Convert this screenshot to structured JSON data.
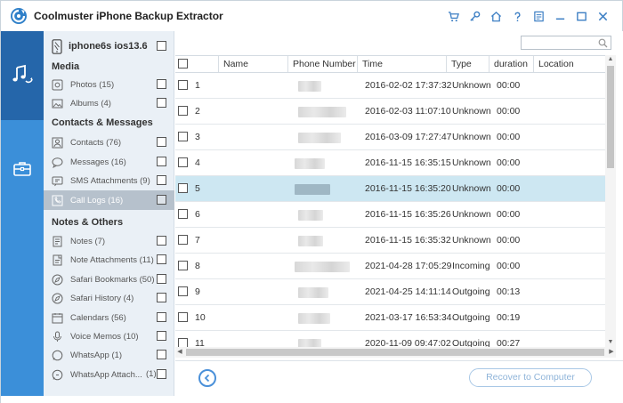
{
  "app": {
    "title": "Coolmuster iPhone Backup Extractor",
    "title_icons": [
      "cart-icon",
      "key-icon",
      "home-icon",
      "help-icon",
      "feedback-icon",
      "minimize-icon",
      "maximize-icon",
      "close-icon"
    ],
    "accent_color": "#3b8fd9",
    "rail_active_color": "#2566aa"
  },
  "device": {
    "name": "iphone6s ios13.6"
  },
  "sections": {
    "media": "Media",
    "contacts_messages": "Contacts & Messages",
    "notes_others": "Notes & Others"
  },
  "categories": [
    {
      "label": "Photos  (15)",
      "icon": "photo-icon"
    },
    {
      "label": "Albums  (4)",
      "icon": "album-icon"
    },
    {
      "label": "Contacts  (76)",
      "icon": "contacts-icon"
    },
    {
      "label": "Messages  (16)",
      "icon": "messages-icon"
    },
    {
      "label": "SMS Attachments  (9)",
      "icon": "attachment-icon"
    },
    {
      "label": "Call Logs  (16)",
      "icon": "call-log-icon",
      "selected": true
    },
    {
      "label": "Notes  (7)",
      "icon": "notes-icon"
    },
    {
      "label": "Note Attachments  (11)",
      "icon": "note-attachment-icon"
    },
    {
      "label": "Safari Bookmarks  (50)",
      "icon": "bookmark-icon"
    },
    {
      "label": "Safari History  (4)",
      "icon": "history-icon"
    },
    {
      "label": "Calendars  (56)",
      "icon": "calendar-icon"
    },
    {
      "label": "Voice Memos  (10)",
      "icon": "voice-memo-icon"
    },
    {
      "label": "WhatsApp  (1)",
      "icon": "whatsapp-icon"
    },
    {
      "label": "WhatsApp Attach...",
      "icon": "whatsapp-attachment-icon",
      "count": "(1)"
    }
  ],
  "table": {
    "columns": [
      "Name",
      "Phone Number",
      "Time",
      "Type",
      "duration",
      "Location"
    ],
    "rows": [
      {
        "index": "1",
        "time": "2016-02-02 17:37:32",
        "type": "Unknown",
        "duration": "00:00"
      },
      {
        "index": "2",
        "time": "2016-02-03 11:07:10",
        "type": "Unknown",
        "duration": "00:00"
      },
      {
        "index": "3",
        "time": "2016-03-09 17:27:47",
        "type": "Unknown",
        "duration": "00:00"
      },
      {
        "index": "4",
        "time": "2016-11-15 16:35:15",
        "type": "Unknown",
        "duration": "00:00"
      },
      {
        "index": "5",
        "time": "2016-11-15 16:35:20",
        "type": "Unknown",
        "duration": "00:00",
        "selected": true
      },
      {
        "index": "6",
        "time": "2016-11-15 16:35:26",
        "type": "Unknown",
        "duration": "00:00"
      },
      {
        "index": "7",
        "time": "2016-11-15 16:35:32",
        "type": "Unknown",
        "duration": "00:00"
      },
      {
        "index": "8",
        "time": "2021-04-28 17:05:29",
        "type": "Incoming",
        "duration": "00:00"
      },
      {
        "index": "9",
        "time": "2021-04-25 14:11:14",
        "type": "Outgoing",
        "duration": "00:13"
      },
      {
        "index": "10",
        "time": "2021-03-17 16:53:34",
        "type": "Outgoing",
        "duration": "00:19"
      },
      {
        "index": "11",
        "time": "2020-11-09 09:47:02",
        "type": "Outgoing",
        "duration": "00:27"
      }
    ]
  },
  "footer": {
    "recover_label": "Recover to Computer"
  }
}
